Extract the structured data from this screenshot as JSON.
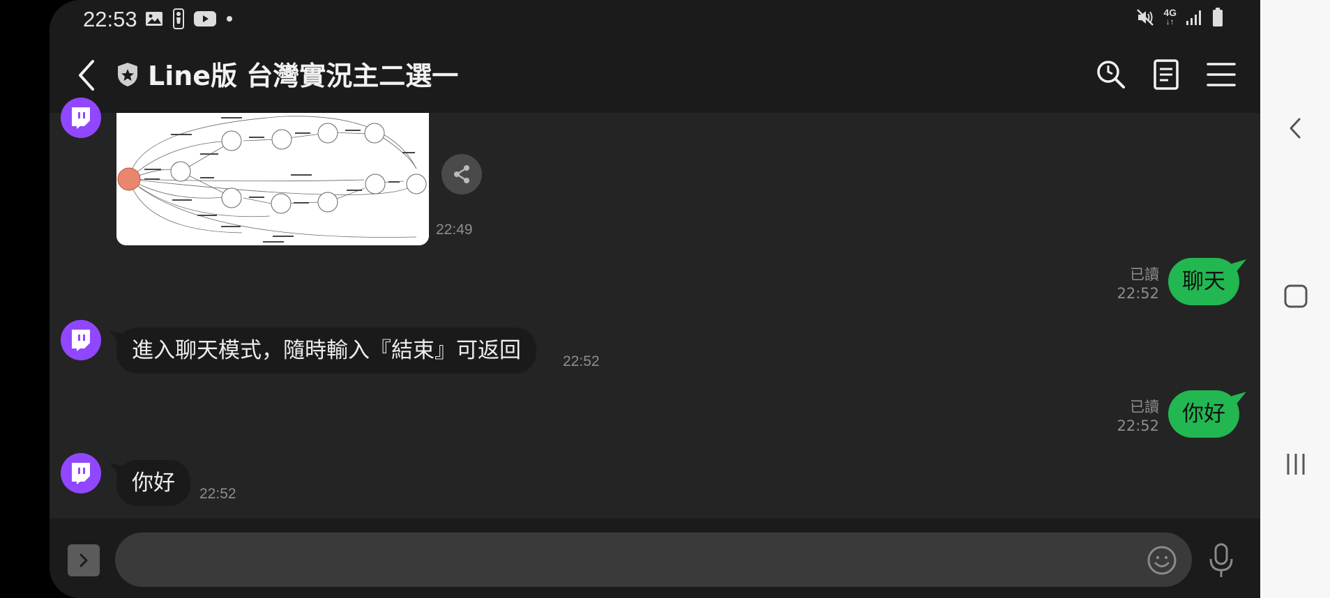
{
  "status_bar": {
    "time": "22:53",
    "network": "4G",
    "left_icons": [
      "image-icon",
      "nba-icon",
      "youtube-icon",
      "dot-icon"
    ],
    "right_icons": [
      "mute-icon",
      "network-4g-icon",
      "signal-icon",
      "battery-icon"
    ]
  },
  "header": {
    "title": "Line版 台灣實況主二選一",
    "icons": [
      "back-icon",
      "shield-icon",
      "search-icon",
      "notes-icon",
      "menu-icon"
    ]
  },
  "messages": [
    {
      "type": "image",
      "direction": "in",
      "time": "22:49",
      "content": "state-diagram-image"
    },
    {
      "type": "text",
      "direction": "out",
      "text": "聊天",
      "read_label": "已讀",
      "time": "22:52"
    },
    {
      "type": "text",
      "direction": "in",
      "text": "進入聊天模式，隨時輸入『結束』可返回",
      "time": "22:52"
    },
    {
      "type": "text",
      "direction": "out",
      "text": "你好",
      "read_label": "已讀",
      "time": "22:52"
    },
    {
      "type": "text",
      "direction": "in",
      "text": "你好",
      "time": "22:52"
    }
  ],
  "input": {
    "value": "",
    "placeholder": ""
  },
  "colors": {
    "outgoing_bubble": "#22b751",
    "incoming_bubble": "#1a1a1a",
    "avatar": "#9147ff",
    "chat_background": "#242424",
    "bar_background": "#1b1b1b"
  }
}
